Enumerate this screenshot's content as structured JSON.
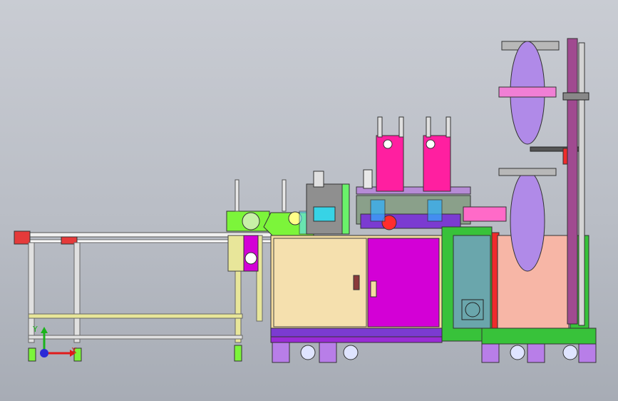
{
  "view": {
    "triad_axes": [
      "X",
      "Y"
    ]
  },
  "colors": {
    "background": "#bcc0c8",
    "frame_white": "#f2f2f2",
    "frame_yellow": "#e8e69a",
    "cabinet_left": "#f4dca0",
    "cabinet_mid": "#d300d6",
    "cabinet_right_panel": "#6aa6ac",
    "cabinet_right": "#f7b6a6",
    "green": "#38c23a",
    "pink": "#ff1fa0",
    "purple_roll": "#b08ae8",
    "purple": "#9a2bd6",
    "red": "#ef2b2b",
    "lime": "#7cf53a",
    "x_axis": "#e01b1b",
    "y_axis": "#1bb31b",
    "z_axis": "#2a2ad6"
  }
}
